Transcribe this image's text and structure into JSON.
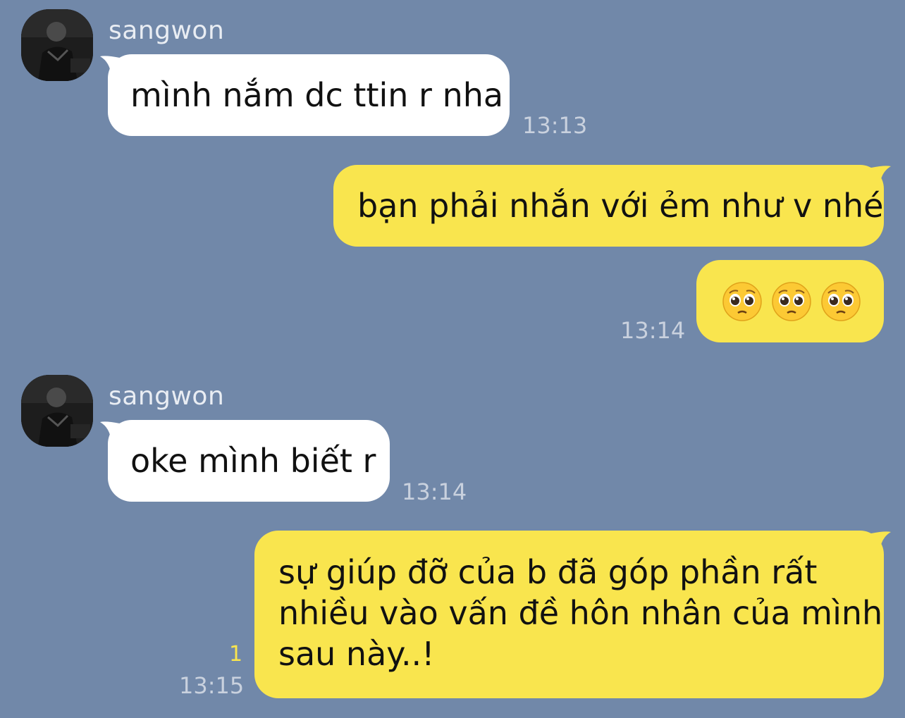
{
  "messages": [
    {
      "sender": "sangwon",
      "text": "mình nắm dc ttin r nha",
      "time": "13:13"
    },
    {
      "text": "bạn phải nhắn với ẻm như v nhé"
    },
    {
      "emoji": [
        "pleading-face",
        "pleading-face",
        "pleading-face"
      ],
      "time": "13:14"
    },
    {
      "sender": "sangwon",
      "text": "oke mình biết r",
      "time": "13:14"
    },
    {
      "lines": [
        "sự giúp đỡ của b đã góp phần rất",
        "nhiều vào vấn đề hôn nhân của mình",
        "sau này..!"
      ],
      "unread": "1",
      "time": "13:15"
    }
  ],
  "colors": {
    "background": "#7188a9",
    "incoming_bubble": "#ffffff",
    "outgoing_bubble": "#f9e54e",
    "unread_count": "#f9e54e"
  }
}
